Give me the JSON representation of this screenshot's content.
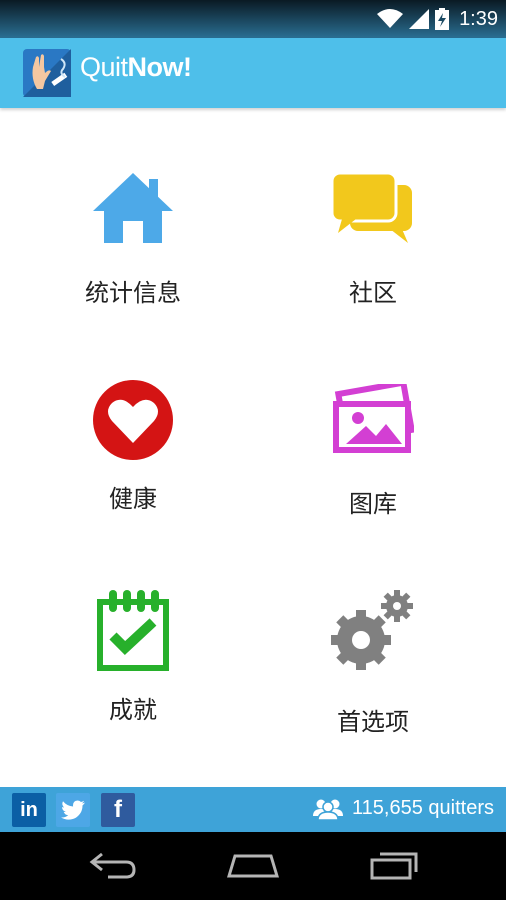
{
  "status_bar": {
    "time": "1:39"
  },
  "app": {
    "title_part1": "Quit",
    "title_part2": "Now!"
  },
  "menu": {
    "items": [
      {
        "label": "统计信息",
        "icon": "house-icon",
        "color": "#4da9e8"
      },
      {
        "label": "社区",
        "icon": "chat-bubbles-icon",
        "color": "#f2c81c"
      },
      {
        "label": "健康",
        "icon": "heart-icon",
        "color": "#d41414"
      },
      {
        "label": "图库",
        "icon": "photos-icon",
        "color": "#d33fd3"
      },
      {
        "label": "成就",
        "icon": "calendar-check-icon",
        "color": "#27b02b"
      },
      {
        "label": "首选项",
        "icon": "gears-icon",
        "color": "#808080"
      }
    ]
  },
  "footer": {
    "linkedin": "in",
    "facebook": "f",
    "quitters_count": "115,655 quitters"
  },
  "colors": {
    "app_bar": "#4ebfea",
    "footer": "#3ea3d8"
  }
}
